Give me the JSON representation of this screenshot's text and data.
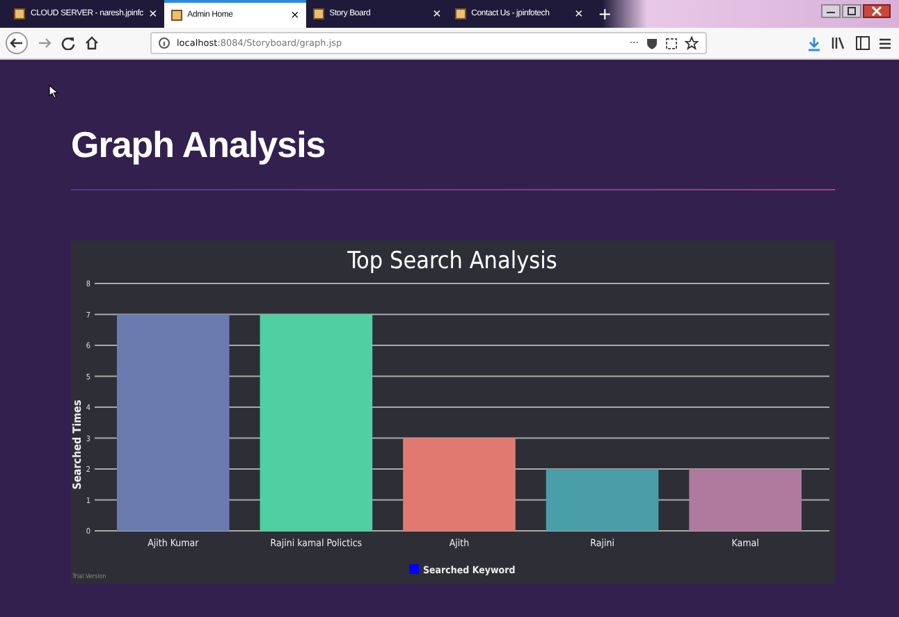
{
  "browser": {
    "tabs": [
      {
        "title": "CLOUD SERVER - naresh.jpinfc",
        "selected": false,
        "close": "×"
      },
      {
        "title": "Admin Home",
        "selected": true,
        "close": "×"
      },
      {
        "title": "Story Board",
        "selected": false,
        "close": "×"
      },
      {
        "title": "Contact Us - jpinfotech",
        "selected": false,
        "close": "×"
      }
    ],
    "new_tab": "+",
    "url_host": "localhost",
    "url_rest": ":8084/Storyboard/graph.jsp",
    "more": "···"
  },
  "page": {
    "heading": "Graph Analysis"
  },
  "chart": {
    "bars": [
      {
        "color": "#6b7bb0"
      },
      {
        "color": "#50cfa3"
      },
      {
        "color": "#e07a70"
      },
      {
        "color": "#4a9ea8"
      },
      {
        "color": "#b07a9e"
      }
    ],
    "trial_text": "Trial Version",
    "legend": {
      "color": "#0000ff"
    },
    "chart_data": {
      "type": "bar",
      "title": "Top Search Analysis",
      "ylabel": "Searched Times",
      "categories": [
        "Ajith Kumar",
        "Rajini kamal Polictics",
        "Ajith",
        "Rajini",
        "Kamal"
      ],
      "series": [
        {
          "name": "Searched Keyword",
          "values": [
            7,
            7,
            3,
            2,
            2
          ]
        }
      ],
      "ylim": [
        0,
        8
      ],
      "grid": true,
      "yticks": [
        0,
        1,
        2,
        3,
        4,
        5,
        6,
        7,
        8
      ]
    }
  }
}
